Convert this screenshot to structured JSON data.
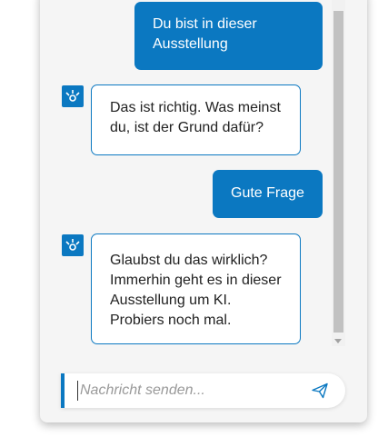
{
  "messages": [
    {
      "sender": "user",
      "text": "Du bist in dieser Ausstellung"
    },
    {
      "sender": "bot",
      "text": "Das ist richtig. Was meinst du, ist der Grund dafür?"
    },
    {
      "sender": "user",
      "text": "Gute Frage"
    },
    {
      "sender": "bot",
      "text": "Glaubst du das wirklich? Immerhin geht es in dieser Ausstellung um KI. Probiers noch mal."
    }
  ],
  "composer": {
    "placeholder": "Nachricht senden...",
    "value": ""
  },
  "icons": {
    "bot_avatar": "bot-logo-icon",
    "send": "paper-plane-icon",
    "scroll_down": "scroll-down-arrow-icon"
  },
  "colors": {
    "accent": "#0b78c1",
    "bot_bubble_bg": "#ffffff",
    "user_text": "#ffffff",
    "window_bg": "#f5f5f5"
  }
}
